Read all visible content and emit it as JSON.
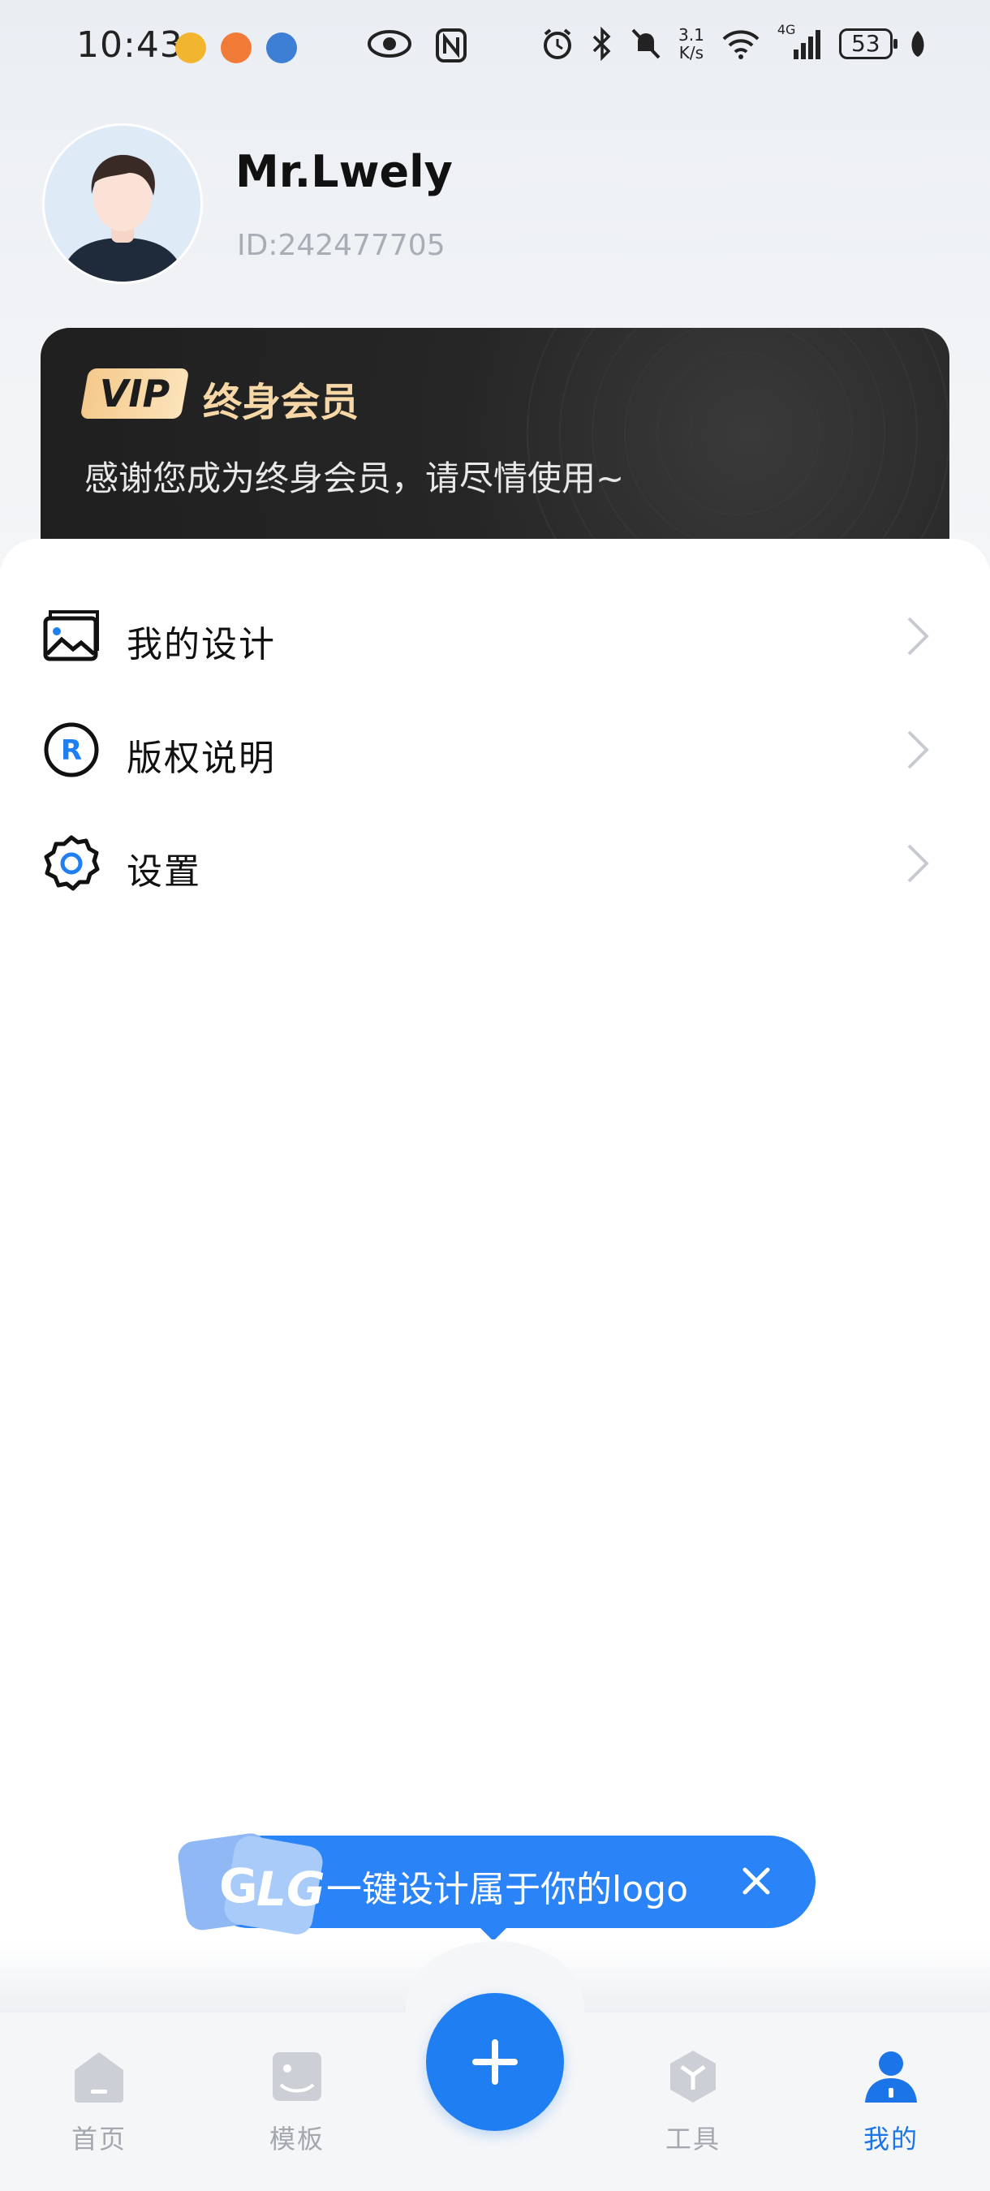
{
  "status_bar": {
    "time": "10:43",
    "speed_top": "3.1",
    "speed_bottom": "K/s",
    "network": "4G",
    "battery": "53"
  },
  "profile": {
    "username": "Mr.Lwely",
    "user_id": "ID:242477705"
  },
  "vip": {
    "badge": "VIP",
    "title": "终身会员",
    "description": "感谢您成为终身会员，请尽情使用~",
    "accent_color": "#f6d7a5"
  },
  "menu": [
    {
      "label": "我的设计",
      "icon": "image-icon"
    },
    {
      "label": "版权说明",
      "icon": "registered-icon"
    },
    {
      "label": "设置",
      "icon": "gear-icon"
    }
  ],
  "promo": {
    "text": "一键设计属于你的logo"
  },
  "bottom_nav": {
    "items": [
      {
        "label": "首页",
        "icon": "home-icon"
      },
      {
        "label": "模板",
        "icon": "template-icon"
      },
      {
        "label": "工具",
        "icon": "tools-icon"
      },
      {
        "label": "我的",
        "icon": "profile-icon",
        "active": true
      }
    ]
  },
  "colors": {
    "accent": "#1f7ff2",
    "active_tab": "#1b74e8",
    "inactive_tab": "#a3a7ae"
  }
}
